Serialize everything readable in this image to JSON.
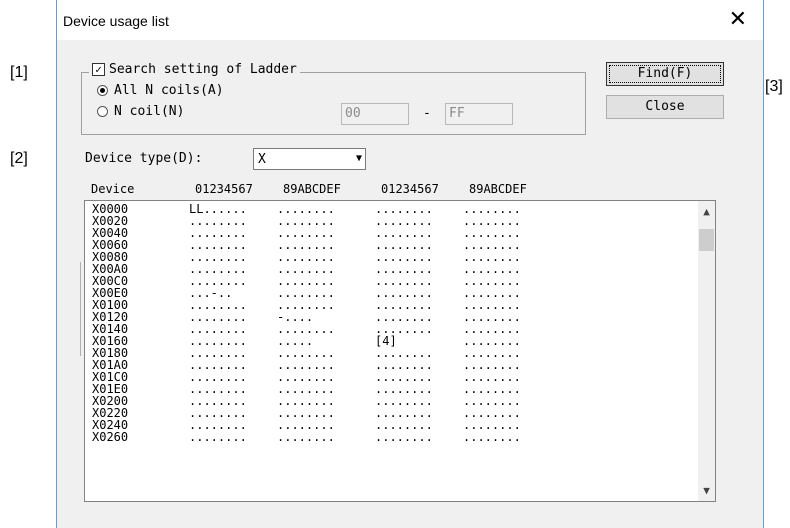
{
  "callouts": [
    "[1]",
    "[2]",
    "[3]",
    "[4]"
  ],
  "dialog": {
    "title": "Device usage list",
    "close_glyph": "✕"
  },
  "search": {
    "legend": "Search setting of Ladder",
    "checked": true,
    "all_coils": "All N coils(A)",
    "n_coil": "N coil(N)",
    "range_from": "00",
    "range_dash": "-",
    "range_to": "FF"
  },
  "buttons": {
    "find": "Find(F)",
    "close": "Close"
  },
  "device_type": {
    "label": "Device type(D):",
    "value": "X"
  },
  "list": {
    "header": {
      "device": "Device",
      "g1": "01234567",
      "g2": "89ABCDEF",
      "g3": "01234567",
      "g4": "89ABCDEF"
    },
    "rows": [
      [
        "X0000",
        "LL......",
        "........",
        "........",
        "........"
      ],
      [
        "X0020",
        "........",
        "........",
        "........",
        "........"
      ],
      [
        "X0040",
        "........",
        "........",
        "........",
        "........"
      ],
      [
        "X0060",
        "........",
        "........",
        "........",
        "........"
      ],
      [
        "X0080",
        "........",
        "........",
        "........",
        "........"
      ],
      [
        "X00A0",
        "........",
        "........",
        "........",
        "........"
      ],
      [
        "X00C0",
        "........",
        "........",
        "........",
        "........"
      ],
      [
        "X00E0",
        "...-..",
        "........",
        "........",
        "........"
      ],
      [
        "X0100",
        "........",
        "........",
        "........",
        "........"
      ],
      [
        "X0120",
        "........",
        "-....",
        "........",
        "........"
      ],
      [
        "X0140",
        "........",
        "........",
        "........",
        "........"
      ],
      [
        "X0160",
        "........",
        ".....",
        "[4]",
        "........"
      ],
      [
        "X0180",
        "........",
        "........",
        "........",
        "........"
      ],
      [
        "X01A0",
        "........",
        "........",
        "........",
        "........"
      ],
      [
        "X01C0",
        "........",
        "........",
        "........",
        "........"
      ],
      [
        "X01E0",
        "........",
        "........",
        "........",
        "........"
      ],
      [
        "X0200",
        "........",
        "........",
        "........",
        "........"
      ],
      [
        "X0220",
        "........",
        "........",
        "........",
        "........"
      ],
      [
        "X0240",
        "........",
        "........",
        "........",
        "........"
      ],
      [
        "X0260",
        "........",
        "........",
        "........",
        "........"
      ]
    ]
  },
  "icons": {
    "scroll_up": "▲",
    "scroll_down": "▼",
    "dropdown": "▼"
  }
}
